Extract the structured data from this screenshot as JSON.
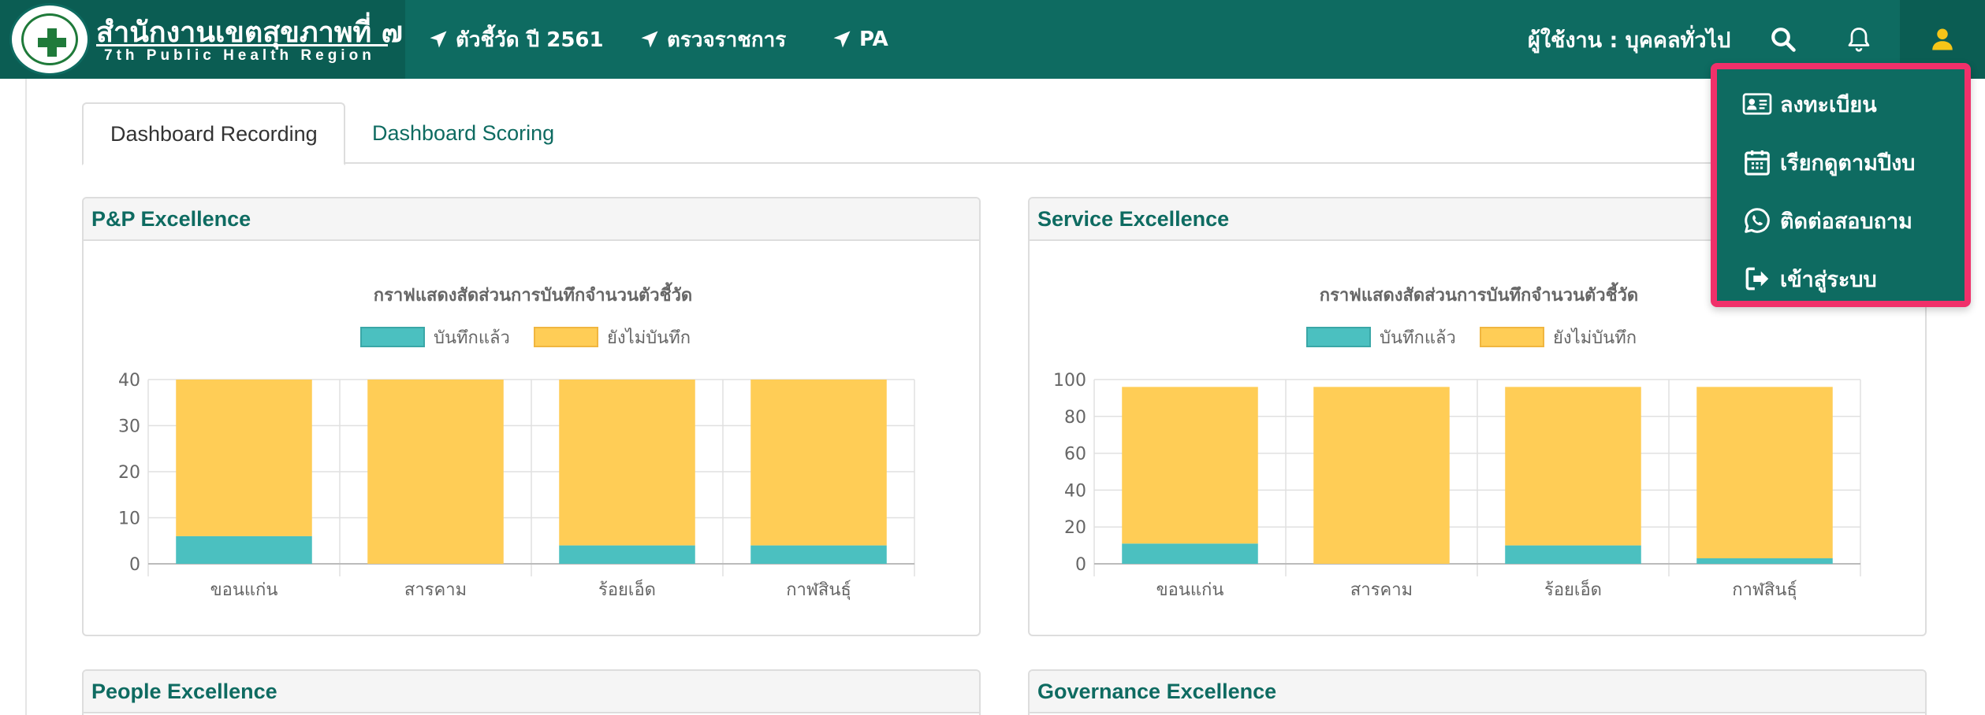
{
  "navbar": {
    "brand_title": "สำนักงานเขตสุขภาพที่ ๗",
    "brand_subtitle": "7th Public Health Region",
    "items": [
      {
        "label": "ตัวชี้วัด ปี 2561",
        "icon": "navigation-arrow-icon"
      },
      {
        "label": "ตรวจราชการ",
        "icon": "navigation-arrow-icon"
      },
      {
        "label": "PA",
        "icon": "navigation-arrow-icon"
      }
    ],
    "user_label": "ผู้ใช้งาน : บุคคลทั่วไป",
    "icons": [
      "search-icon",
      "bell-icon",
      "user-icon"
    ],
    "user_icon_color": "#f5c518"
  },
  "dropdown": {
    "border_color": "#f0306a",
    "items": [
      {
        "label": "ลงทะเบียน",
        "icon": "id-card-icon"
      },
      {
        "label": "เรียกดูตามปีงบ",
        "icon": "calendar-icon"
      },
      {
        "label": "ติดต่อสอบถาม",
        "icon": "whatsapp-icon"
      },
      {
        "label": "เข้าสู่ระบบ",
        "icon": "sign-in-icon"
      }
    ]
  },
  "tabs": [
    {
      "label": "Dashboard Recording",
      "active": true
    },
    {
      "label": "Dashboard Scoring",
      "active": false
    }
  ],
  "panels": [
    {
      "title": "P&P Excellence"
    },
    {
      "title": "Service Excellence"
    },
    {
      "title": "People Excellence"
    },
    {
      "title": "Governance Excellence"
    }
  ],
  "colors": {
    "primary": "#0e6b61",
    "recorded": "#4bc0c0",
    "not_recorded": "#ffcd56"
  },
  "chart_data": [
    {
      "type": "bar",
      "stacked": true,
      "title": "กราฟแสดงสัดส่วนการบันทึกจำนวนตัวชี้วัด",
      "categories": [
        "ขอนแก่น",
        "สารคาม",
        "ร้อยเอ็ด",
        "กาฬสินธุ์"
      ],
      "series": [
        {
          "name": "บันทึกแล้ว",
          "values": [
            6,
            0,
            4,
            4
          ]
        },
        {
          "name": "ยังไม่บันทึก",
          "values": [
            34,
            40,
            36,
            36
          ]
        }
      ],
      "ylim": [
        0,
        40
      ],
      "yticks": [
        0,
        10,
        20,
        30,
        40
      ],
      "grid": true,
      "legend": "top-center"
    },
    {
      "type": "bar",
      "stacked": true,
      "title": "กราฟแสดงสัดส่วนการบันทึกจำนวนตัวชี้วัด",
      "categories": [
        "ขอนแก่น",
        "สารคาม",
        "ร้อยเอ็ด",
        "กาฬสินธุ์"
      ],
      "series": [
        {
          "name": "บันทึกแล้ว",
          "values": [
            11,
            0,
            10,
            3
          ]
        },
        {
          "name": "ยังไม่บันทึก",
          "values": [
            85,
            96,
            86,
            93
          ]
        }
      ],
      "ylim": [
        0,
        100
      ],
      "yticks": [
        0,
        20,
        40,
        60,
        80,
        100
      ],
      "grid": true,
      "legend": "top-center"
    }
  ]
}
